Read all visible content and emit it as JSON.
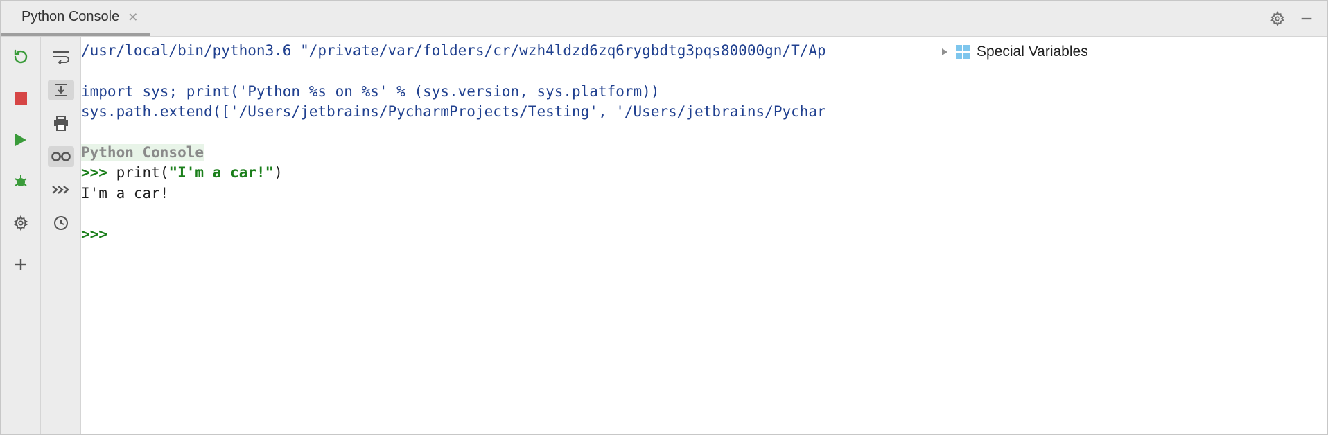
{
  "tab": {
    "title": "Python Console"
  },
  "console": {
    "line1": "/usr/local/bin/python3.6 \"/private/var/folders/cr/wzh4ldzd6zq6rygbdtg3pqs80000gn/T/Ap",
    "line2_a": "import",
    "line2_b": " sys; print(",
    "line2_c": "'Python %s on %s'",
    "line2_d": " % (sys.version, sys.platform))",
    "line3_a": "sys.path.extend([",
    "line3_b": "'/Users/jetbrains/PycharmProjects/Testing'",
    "line3_c": ", ",
    "line3_d": "'/Users/jetbrains/Pychar",
    "banner": "Python Console",
    "prompt1": ">>> ",
    "call_a": "print(",
    "call_b": "\"I'm a car!\"",
    "call_c": ")",
    "output": "I'm a car!",
    "prompt2": ">>> "
  },
  "vars": {
    "special": "Special Variables"
  }
}
